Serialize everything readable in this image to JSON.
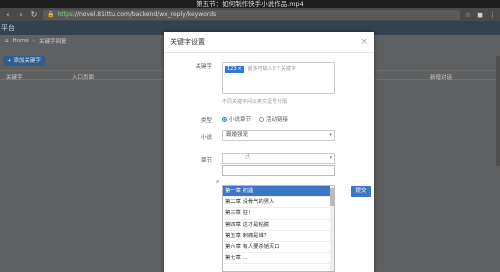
{
  "video": {
    "title": "第五节：如何制作快手小说作品.mp4"
  },
  "browser": {
    "url_scheme": "https",
    "url_rest": "://novel.81ittu.com/backend/wx_reply/keywords",
    "icons": [
      "back-icon",
      "forward-icon",
      "reload-icon",
      "star-icon",
      "menu-icon"
    ]
  },
  "app": {
    "header": "平台",
    "breadcrumb_home": "Home",
    "breadcrumb_current": "关键字回复",
    "add_button": "+ 添加关键字",
    "table_headers": [
      "关键字",
      "入口页面",
      "",
      "",
      "",
      "新增对话"
    ]
  },
  "modal": {
    "title": "关键字设置",
    "keyword_label": "关键字",
    "tag_value": "123",
    "keyword_placeholder": "最多可输入5个关键字",
    "hint": "不同关键字间以英文逗号分隔",
    "type_label": "类型",
    "type_option1": "小说章节",
    "type_option2": "活动链接",
    "novel_label": "小说",
    "novel_value": "霸婚强宠",
    "chapter_label": "章节",
    "chapter_value": "",
    "search_value": "",
    "submit": "提交",
    "chapters": [
      "第一章 初遇",
      "第二章 没骨气的男人",
      "第三章 狂！",
      "第四章 这才是粘腻",
      "第五章 刺痛是谁？",
      "第六章 有人要杀她灭口",
      "第七章 ..."
    ]
  }
}
